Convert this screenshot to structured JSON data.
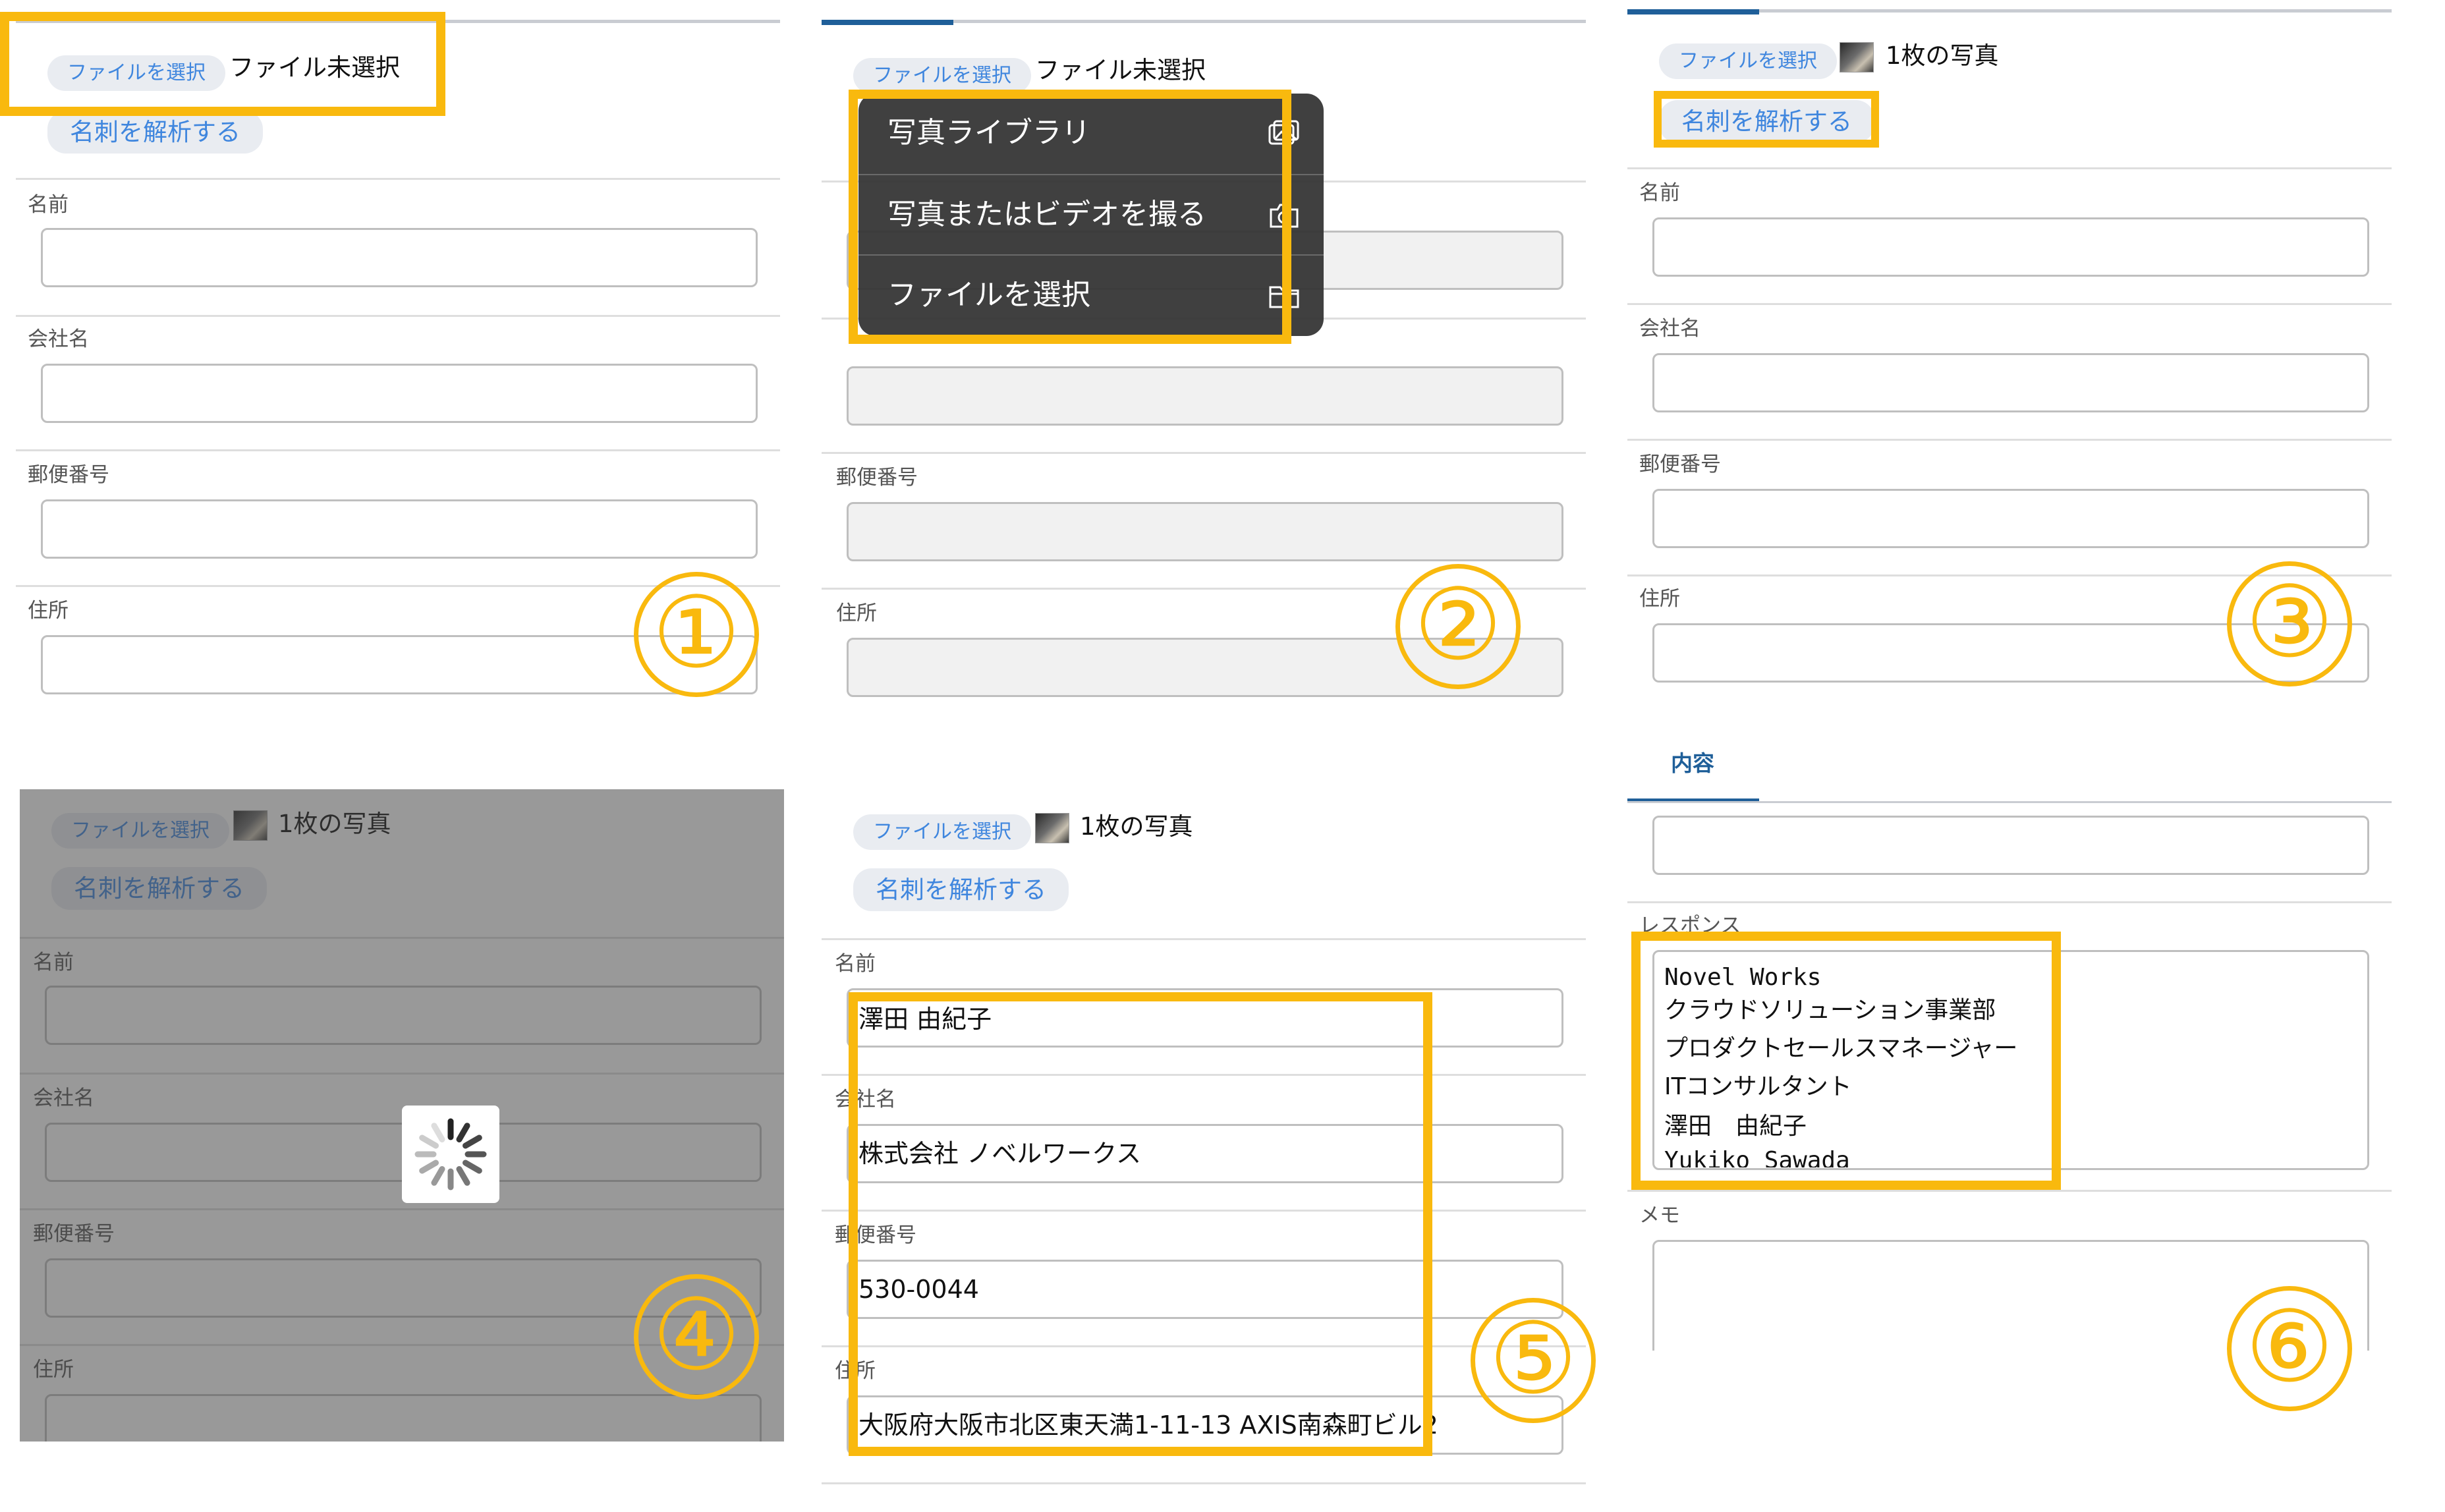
{
  "colors": {
    "highlight": "#f9b90e",
    "accent": "#3f86de",
    "tab_underline": "#1f5f99"
  },
  "file_button_label": "ファイルを選択",
  "no_file_label": "ファイル未選択",
  "one_photo_label": "1枚の写真",
  "analyze_button_label": "名刺を解析する",
  "fields": {
    "name": "名前",
    "company": "会社名",
    "postal": "郵便番号",
    "address": "住所"
  },
  "picker_menu": {
    "items": [
      {
        "label": "写真ライブラリ",
        "icon": "photo-library-icon"
      },
      {
        "label": "写真またはビデオを撮る",
        "icon": "camera-icon"
      },
      {
        "label": "ファイルを選択",
        "icon": "folder-icon"
      }
    ]
  },
  "result_values": {
    "name": "澤田 由紀子",
    "company": "株式会社 ノベルワークス",
    "postal": "530-0044",
    "address": "大阪府大阪市北区東天満1-11-13 AXIS南森町ビル2"
  },
  "panel6": {
    "tab_label": "内容",
    "response_label": "レスポンス",
    "memo_label": "メモ",
    "response_lines": [
      "Novel Works",
      "クラウドソリューション事業部",
      "プロダクトセールスマネージャー",
      "ITコンサルタント",
      "澤田　由紀子",
      "Yukiko Sawada"
    ]
  },
  "step_numbers": [
    "①",
    "②",
    "③",
    "④",
    "⑤",
    "⑥"
  ]
}
